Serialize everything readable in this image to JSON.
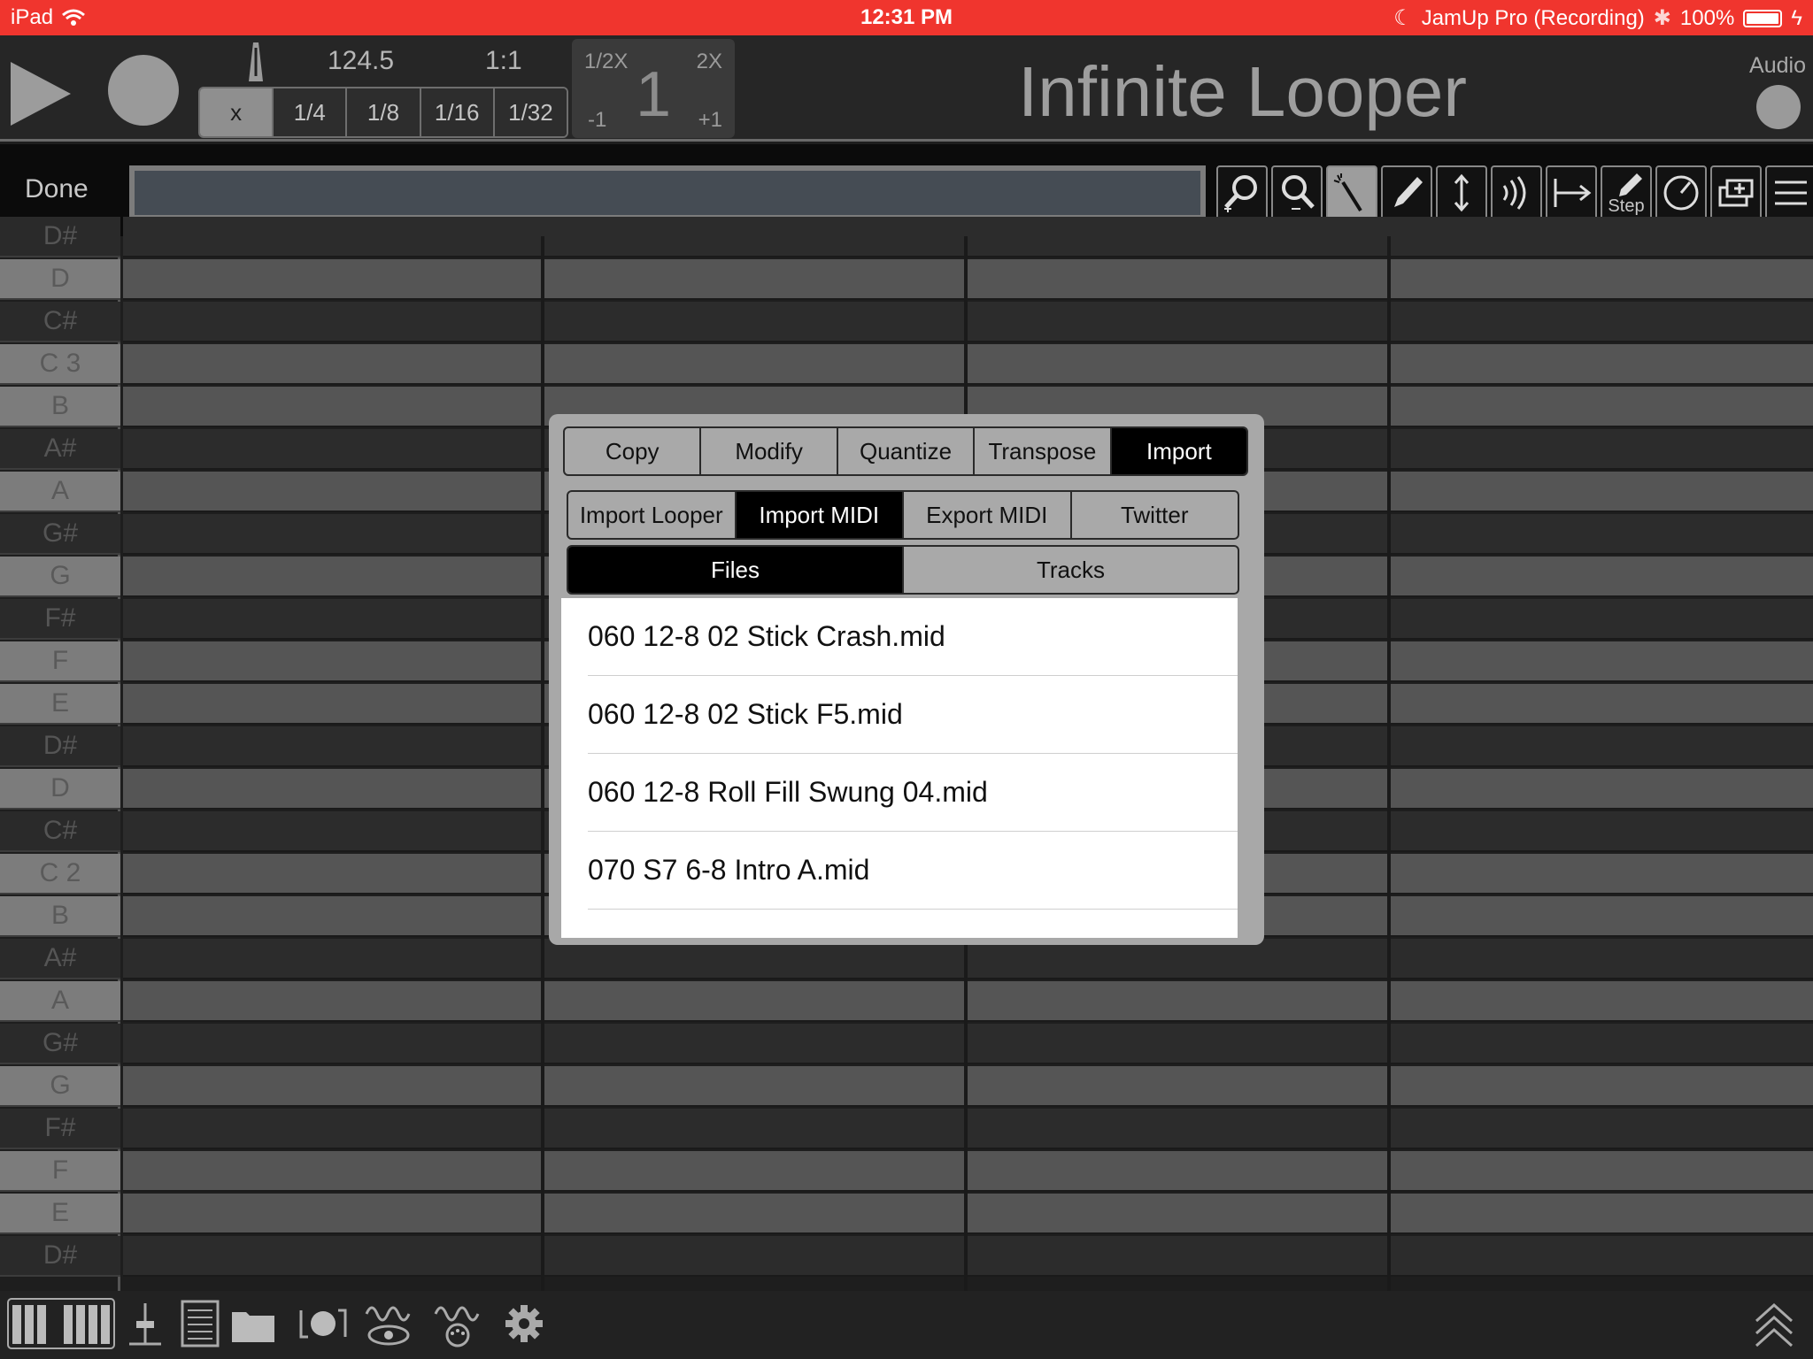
{
  "status_bar": {
    "device": "iPad",
    "time": "12:31 PM",
    "app_context": "JamUp Pro (Recording)",
    "battery": "100%"
  },
  "transport": {
    "tempo": "124.5",
    "position": "1:1",
    "quantize_options": [
      "x",
      "1/4",
      "1/8",
      "1/16",
      "1/32"
    ],
    "quantize_selected": "x",
    "speed": {
      "half_label": "1/2X",
      "double_label": "2X",
      "value": "1",
      "minus_label": "-1",
      "plus_label": "+1"
    },
    "title": "Infinite Looper",
    "audio_label": "Audio"
  },
  "edit_bar": {
    "done_label": "Done",
    "step_label": "Step",
    "tools": [
      "zoom-in-icon",
      "zoom-out-icon",
      "magic-wand-icon",
      "pencil-icon",
      "vertical-arrow-icon",
      "velocity-icon",
      "length-icon",
      "step-pencil-icon",
      "knob-icon",
      "add-track-icon",
      "menu-icon"
    ],
    "selected_tool": "magic-wand-icon"
  },
  "piano_keys": [
    {
      "label": "D#",
      "black": true
    },
    {
      "label": "D",
      "black": false
    },
    {
      "label": "C#",
      "black": true
    },
    {
      "label": "C  3",
      "black": false
    },
    {
      "label": "B",
      "black": false
    },
    {
      "label": "A#",
      "black": true
    },
    {
      "label": "A",
      "black": false
    },
    {
      "label": "G#",
      "black": true
    },
    {
      "label": "G",
      "black": false
    },
    {
      "label": "F#",
      "black": true
    },
    {
      "label": "F",
      "black": false
    },
    {
      "label": "E",
      "black": false
    },
    {
      "label": "D#",
      "black": true
    },
    {
      "label": "D",
      "black": false
    },
    {
      "label": "C#",
      "black": true
    },
    {
      "label": "C  2",
      "black": false
    },
    {
      "label": "B",
      "black": false
    },
    {
      "label": "A#",
      "black": true
    },
    {
      "label": "A",
      "black": false
    },
    {
      "label": "G#",
      "black": true
    },
    {
      "label": "G",
      "black": false
    },
    {
      "label": "F#",
      "black": true
    },
    {
      "label": "F",
      "black": false
    },
    {
      "label": "E",
      "black": false
    },
    {
      "label": "D#",
      "black": true
    }
  ],
  "modal": {
    "main_tabs": [
      "Copy",
      "Modify",
      "Quantize",
      "Transpose",
      "Import"
    ],
    "main_selected": "Import",
    "import_tabs": [
      "Import Looper",
      "Import MIDI",
      "Export MIDI",
      "Twitter"
    ],
    "import_selected": "Import MIDI",
    "view_tabs": [
      "Files",
      "Tracks"
    ],
    "view_selected": "Files",
    "files": [
      "060 12-8 02 Stick Crash.mid",
      "060 12-8 02 Stick F5.mid",
      "060 12-8 Roll Fill Swung 04.mid",
      "070 S7 6-8 Intro A.mid"
    ]
  },
  "bottom_bar": {
    "items": [
      "piano-keys-icon",
      "mixer-icon",
      "notes-list-icon",
      "folder-icon",
      "loop-record-icon",
      "visualize-icon",
      "midi-wave-icon",
      "settings-gear-icon",
      "collapse-chevrons-icon"
    ]
  },
  "colors": {
    "status_bar": "#f0352e",
    "selected": "#000000",
    "modal_bg": "#a8a8a8"
  }
}
